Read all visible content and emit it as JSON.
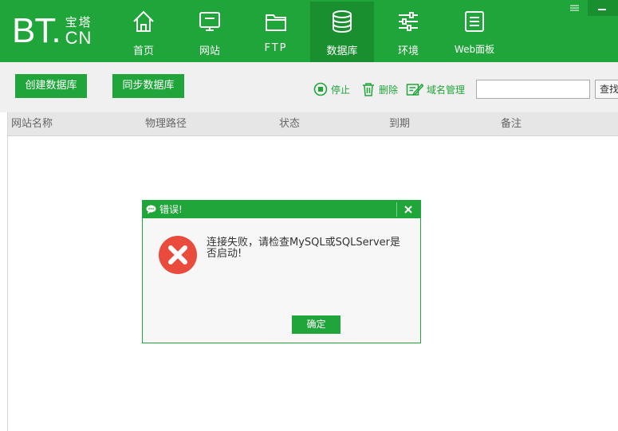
{
  "header": {
    "logo": {
      "main": "BT.",
      "cn": "宝塔",
      "domain": "CN"
    },
    "nav": [
      {
        "label": "首页",
        "icon": "home-icon"
      },
      {
        "label": "网站",
        "icon": "monitor-icon"
      },
      {
        "label": "FTP",
        "icon": "folder-icon"
      },
      {
        "label": "数据库",
        "icon": "database-icon",
        "active": true
      },
      {
        "label": "环境",
        "icon": "sliders-icon"
      },
      {
        "label": "Web面板",
        "icon": "list-icon"
      }
    ]
  },
  "toolbar": {
    "create_label": "创建数据库",
    "sync_label": "同步数据库",
    "stop_label": "停止",
    "delete_label": "删除",
    "domain_label": "域名管理",
    "search_value": "",
    "search_button_label": "查找"
  },
  "table": {
    "columns": [
      "网站名称",
      "物理路径",
      "状态",
      "到期",
      "备注"
    ],
    "rows": []
  },
  "dialog": {
    "title": "错误!",
    "message": "连接失败，请检查MySQL或SQLServer是否启动!",
    "ok_label": "确定"
  },
  "colors": {
    "brand": "#20a53a",
    "brand_dark": "#1a8f30",
    "error": "#e94b3c"
  }
}
